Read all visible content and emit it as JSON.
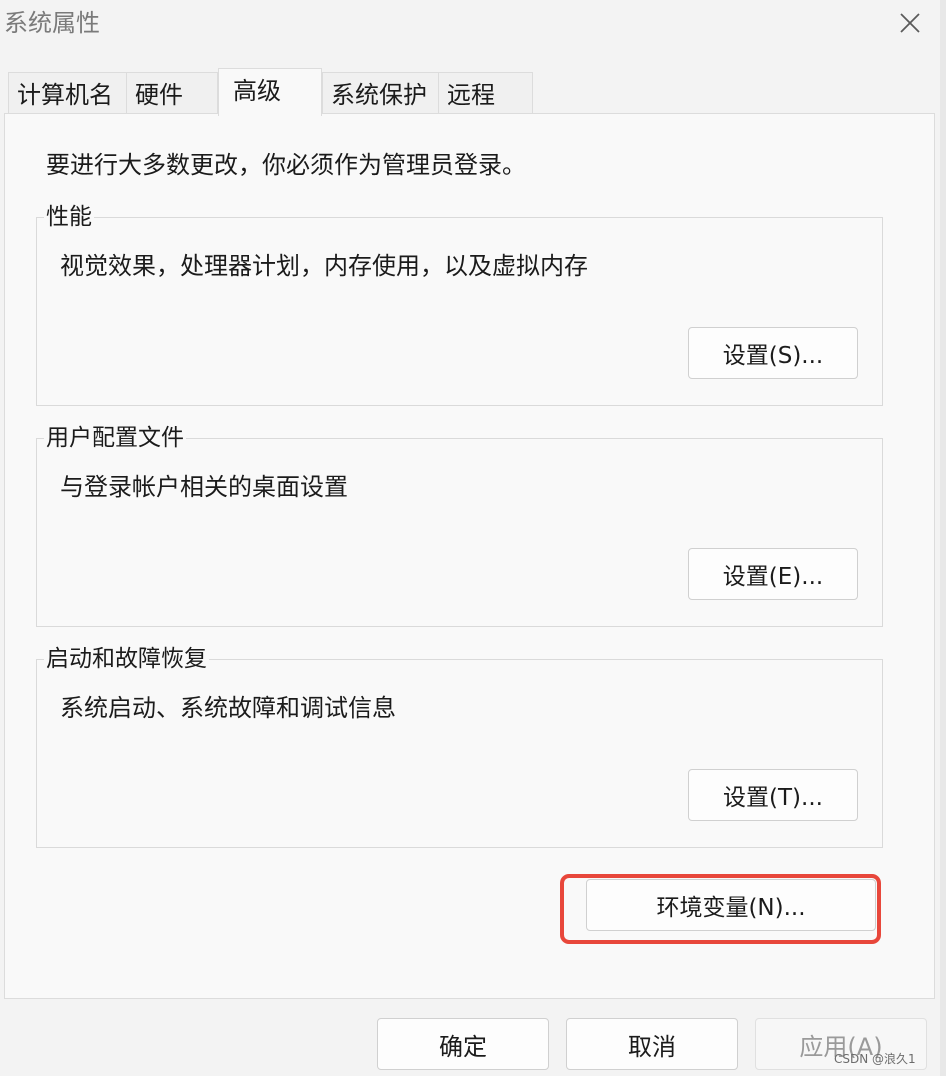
{
  "window": {
    "title": "系统属性"
  },
  "tabs": [
    {
      "label": "计算机名",
      "active": false
    },
    {
      "label": "硬件",
      "active": false
    },
    {
      "label": "高级",
      "active": true
    },
    {
      "label": "系统保护",
      "active": false
    },
    {
      "label": "远程",
      "active": false
    }
  ],
  "content": {
    "intro": "要进行大多数更改，你必须作为管理员登录。",
    "groups": [
      {
        "title": "性能",
        "description": "视觉效果，处理器计划，内存使用，以及虚拟内存",
        "button": "设置(S)..."
      },
      {
        "title": "用户配置文件",
        "description": "与登录帐户相关的桌面设置",
        "button": "设置(E)..."
      },
      {
        "title": "启动和故障恢复",
        "description": "系统启动、系统故障和调试信息",
        "button": "设置(T)..."
      }
    ],
    "env_button": "环境变量(N)..."
  },
  "footer": {
    "ok": "确定",
    "cancel": "取消",
    "apply": "应用(A)"
  },
  "watermark": "CSDN @浪久1",
  "colors": {
    "highlight": "#e8473b"
  },
  "icons": {
    "close": "close-icon"
  }
}
